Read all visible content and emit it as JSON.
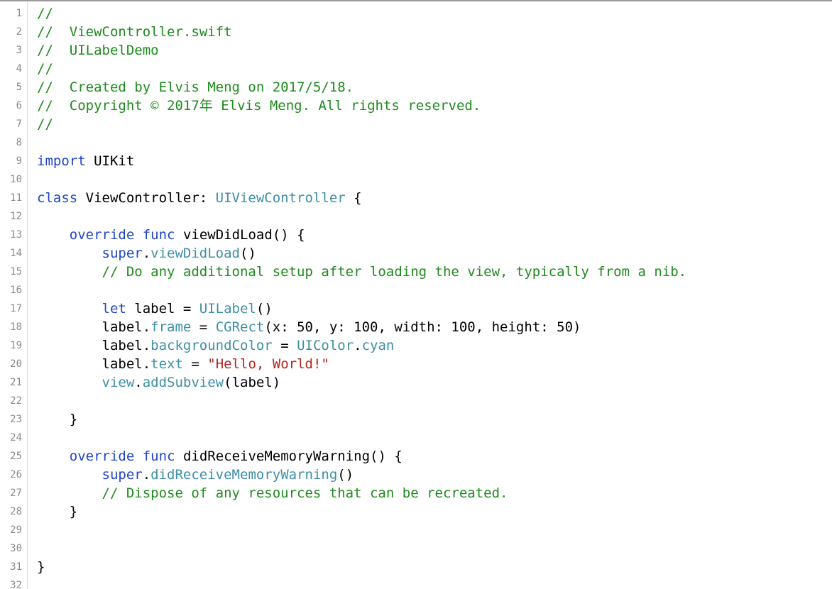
{
  "editor": {
    "language": "swift",
    "colors": {
      "comment": "#1e8a1e",
      "keyword": "#1f45c4",
      "type": "#3d8fa6",
      "string": "#b5261e",
      "plain": "#000000",
      "line_number": "#8a8a8a"
    },
    "lines": [
      {
        "number": "1",
        "tokens": [
          {
            "t": "//",
            "k": "comment"
          }
        ]
      },
      {
        "number": "2",
        "tokens": [
          {
            "t": "//  ViewController.swift",
            "k": "comment"
          }
        ]
      },
      {
        "number": "3",
        "tokens": [
          {
            "t": "//  UILabelDemo",
            "k": "comment"
          }
        ]
      },
      {
        "number": "4",
        "tokens": [
          {
            "t": "//",
            "k": "comment"
          }
        ]
      },
      {
        "number": "5",
        "tokens": [
          {
            "t": "//  Created by Elvis Meng on 2017/5/18.",
            "k": "comment"
          }
        ]
      },
      {
        "number": "6",
        "tokens": [
          {
            "t": "//  Copyright © 2017年 Elvis Meng. All rights reserved.",
            "k": "comment"
          }
        ]
      },
      {
        "number": "7",
        "tokens": [
          {
            "t": "//",
            "k": "comment"
          }
        ]
      },
      {
        "number": "8",
        "tokens": []
      },
      {
        "number": "9",
        "tokens": [
          {
            "t": "import",
            "k": "keyword"
          },
          {
            "t": " UIKit",
            "k": "plain"
          }
        ]
      },
      {
        "number": "10",
        "tokens": []
      },
      {
        "number": "11",
        "tokens": [
          {
            "t": "class",
            "k": "keyword"
          },
          {
            "t": " ViewController: ",
            "k": "plain"
          },
          {
            "t": "UIViewController",
            "k": "type"
          },
          {
            "t": " {",
            "k": "plain"
          }
        ]
      },
      {
        "number": "12",
        "tokens": []
      },
      {
        "number": "13",
        "tokens": [
          {
            "t": "    ",
            "k": "plain"
          },
          {
            "t": "override",
            "k": "keyword"
          },
          {
            "t": " ",
            "k": "plain"
          },
          {
            "t": "func",
            "k": "keyword"
          },
          {
            "t": " viewDidLoad() {",
            "k": "plain"
          }
        ]
      },
      {
        "number": "14",
        "tokens": [
          {
            "t": "        ",
            "k": "plain"
          },
          {
            "t": "super",
            "k": "keyword"
          },
          {
            "t": ".",
            "k": "plain"
          },
          {
            "t": "viewDidLoad",
            "k": "type"
          },
          {
            "t": "()",
            "k": "plain"
          }
        ]
      },
      {
        "number": "15",
        "tokens": [
          {
            "t": "        // Do any additional setup after loading the view, typically from a nib.",
            "k": "comment"
          }
        ]
      },
      {
        "number": "16",
        "tokens": []
      },
      {
        "number": "17",
        "tokens": [
          {
            "t": "        ",
            "k": "plain"
          },
          {
            "t": "let",
            "k": "keyword"
          },
          {
            "t": " label = ",
            "k": "plain"
          },
          {
            "t": "UILabel",
            "k": "type"
          },
          {
            "t": "()",
            "k": "plain"
          }
        ]
      },
      {
        "number": "18",
        "tokens": [
          {
            "t": "        label.",
            "k": "plain"
          },
          {
            "t": "frame",
            "k": "type"
          },
          {
            "t": " = ",
            "k": "plain"
          },
          {
            "t": "CGRect",
            "k": "type"
          },
          {
            "t": "(x: 50, y: 100, width: 100, height: 50)",
            "k": "plain"
          }
        ]
      },
      {
        "number": "19",
        "tokens": [
          {
            "t": "        label.",
            "k": "plain"
          },
          {
            "t": "backgroundColor",
            "k": "type"
          },
          {
            "t": " = ",
            "k": "plain"
          },
          {
            "t": "UIColor",
            "k": "type"
          },
          {
            "t": ".",
            "k": "plain"
          },
          {
            "t": "cyan",
            "k": "type"
          }
        ]
      },
      {
        "number": "20",
        "tokens": [
          {
            "t": "        label.",
            "k": "plain"
          },
          {
            "t": "text",
            "k": "type"
          },
          {
            "t": " = ",
            "k": "plain"
          },
          {
            "t": "\"Hello, World!\"",
            "k": "string"
          }
        ]
      },
      {
        "number": "21",
        "tokens": [
          {
            "t": "        ",
            "k": "plain"
          },
          {
            "t": "view",
            "k": "type"
          },
          {
            "t": ".",
            "k": "plain"
          },
          {
            "t": "addSubview",
            "k": "type"
          },
          {
            "t": "(label)",
            "k": "plain"
          }
        ]
      },
      {
        "number": "22",
        "tokens": []
      },
      {
        "number": "23",
        "tokens": [
          {
            "t": "    }",
            "k": "plain"
          }
        ]
      },
      {
        "number": "24",
        "tokens": []
      },
      {
        "number": "25",
        "tokens": [
          {
            "t": "    ",
            "k": "plain"
          },
          {
            "t": "override",
            "k": "keyword"
          },
          {
            "t": " ",
            "k": "plain"
          },
          {
            "t": "func",
            "k": "keyword"
          },
          {
            "t": " didReceiveMemoryWarning() {",
            "k": "plain"
          }
        ]
      },
      {
        "number": "26",
        "tokens": [
          {
            "t": "        ",
            "k": "plain"
          },
          {
            "t": "super",
            "k": "keyword"
          },
          {
            "t": ".",
            "k": "plain"
          },
          {
            "t": "didReceiveMemoryWarning",
            "k": "type"
          },
          {
            "t": "()",
            "k": "plain"
          }
        ]
      },
      {
        "number": "27",
        "tokens": [
          {
            "t": "        // Dispose of any resources that can be recreated.",
            "k": "comment"
          }
        ]
      },
      {
        "number": "28",
        "tokens": [
          {
            "t": "    }",
            "k": "plain"
          }
        ]
      },
      {
        "number": "29",
        "tokens": []
      },
      {
        "number": "30",
        "tokens": []
      },
      {
        "number": "31",
        "tokens": [
          {
            "t": "}",
            "k": "plain"
          }
        ]
      },
      {
        "number": "32",
        "tokens": []
      }
    ]
  }
}
